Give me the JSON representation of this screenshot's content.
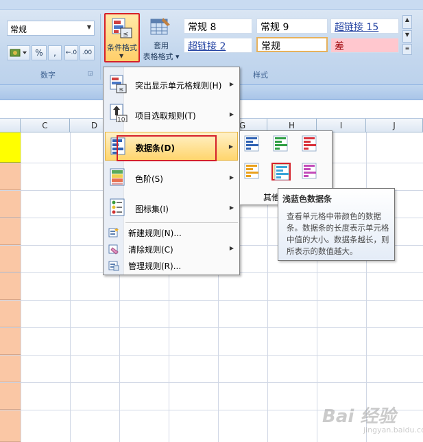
{
  "ribbon": {
    "number_format_value": "常规",
    "number_group_label": "数字",
    "percent_label": "%",
    "comma_label": ",",
    "increase_decimal_label": "←.0",
    "decrease_decimal_label": ".00",
    "conditional_format_label": "条件格式",
    "table_format_line1": "套用",
    "table_format_line2": "表格格式",
    "styles_group_label": "样式",
    "cell_styles": [
      "常规 8",
      "常规 9",
      "超链接 15",
      "超链接 2",
      "常规",
      "差"
    ]
  },
  "grid": {
    "columns": [
      "C",
      "D",
      "G",
      "H",
      "I",
      "J"
    ]
  },
  "menu": {
    "items": [
      {
        "label": "突出显示单元格规则(H)",
        "icon": "highlight-rules-icon"
      },
      {
        "label": "项目选取规则(T)",
        "icon": "top-bottom-icon"
      },
      {
        "label": "数据条(D)",
        "icon": "data-bars-icon"
      },
      {
        "label": "色阶(S)",
        "icon": "color-scales-icon"
      },
      {
        "label": "图标集(I)",
        "icon": "icon-sets-icon"
      },
      {
        "label": "新建规则(N)...",
        "icon": "new-rule-icon"
      },
      {
        "label": "清除规则(C)",
        "icon": "clear-rules-icon"
      },
      {
        "label": "管理规则(R)...",
        "icon": "manage-rules-icon"
      }
    ]
  },
  "submenu": {
    "other_label": "其他",
    "bar_colors": [
      "#2f62b3",
      "#2e9e43",
      "#d8313a",
      "#e9a01c",
      "#3ba5d9",
      "#c24bb9"
    ]
  },
  "tooltip": {
    "title": "浅蓝色数据条",
    "body": "查看单元格中带颜色的数据条。数据条的长度表示单元格中值的大小。数据条越长，则所表示的数值越大。"
  },
  "watermark": {
    "text": "Bai 经验",
    "sub": "jingyan.baidu.com"
  }
}
